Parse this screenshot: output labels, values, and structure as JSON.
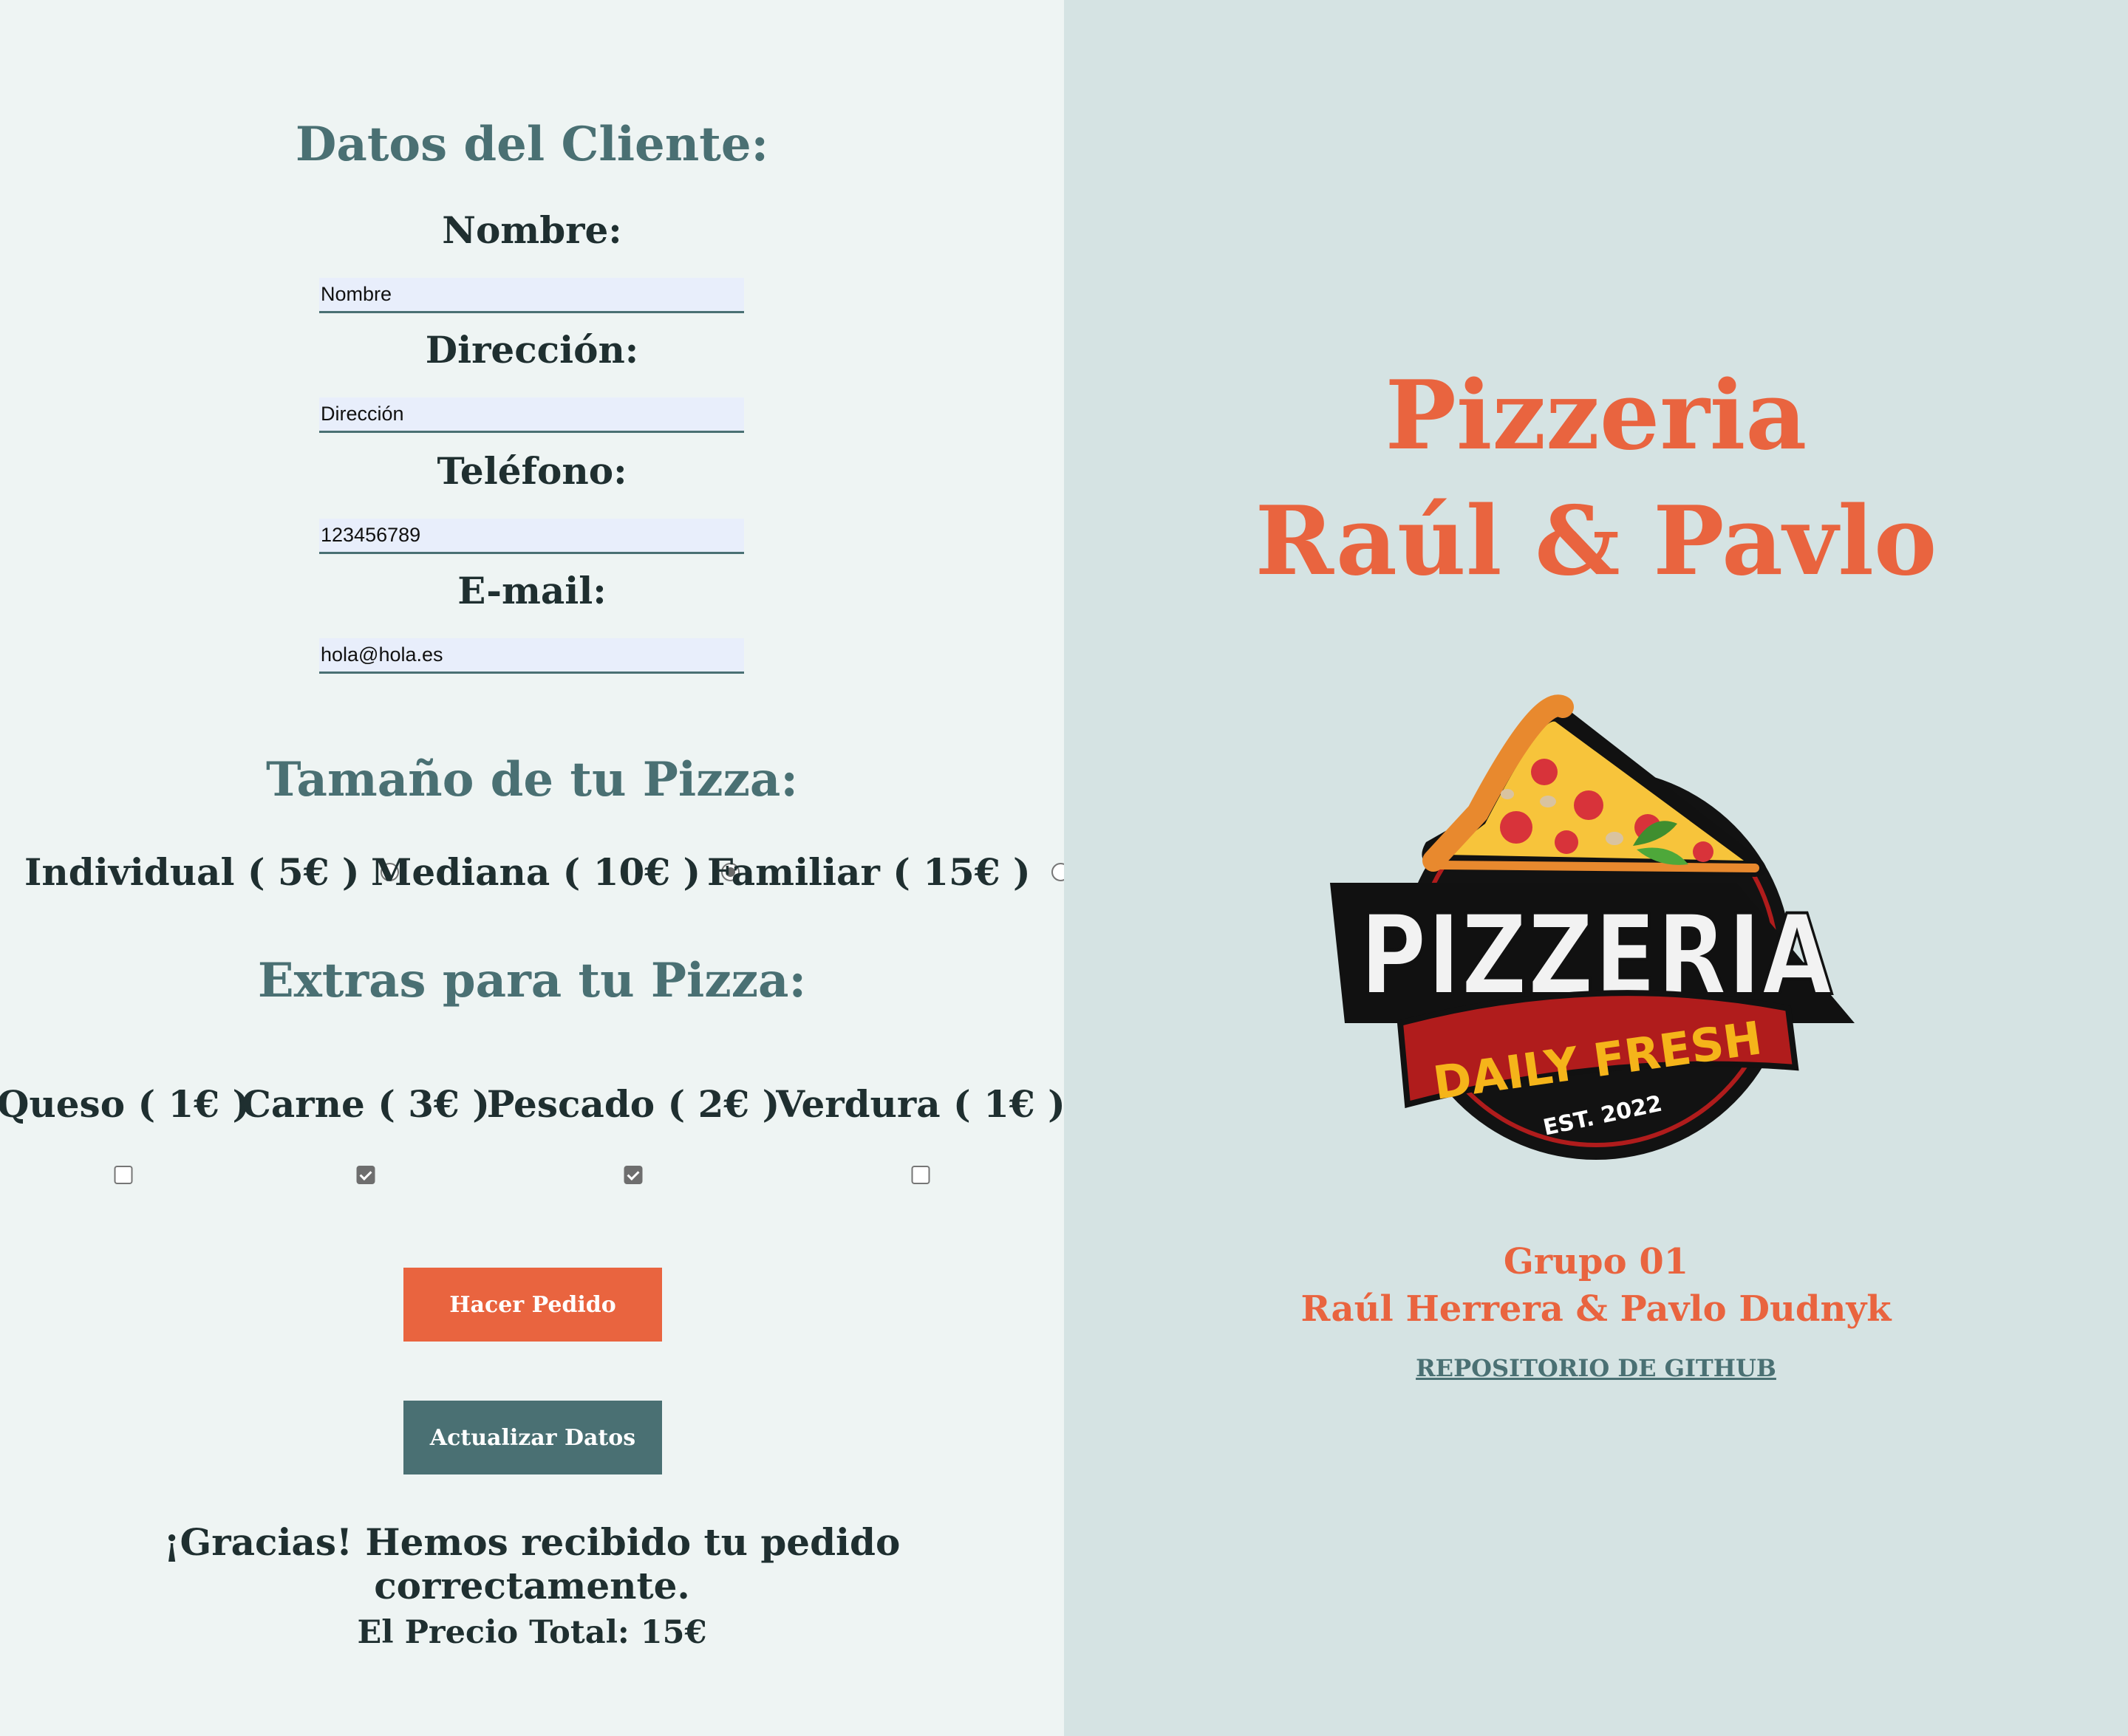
{
  "form": {
    "customer_title": "Datos del Cliente:",
    "name_label": "Nombre:",
    "name_value": "Nombre",
    "address_label": "Dirección:",
    "address_value": "Dirección",
    "phone_label": "Teléfono:",
    "phone_value": "123456789",
    "email_label": "E-mail:",
    "email_value": "hola@hola.es"
  },
  "size": {
    "title": "Tamaño de tu Pizza:",
    "options": [
      {
        "label": "Individual ( 5€ )",
        "selected": false
      },
      {
        "label": "Mediana ( 10€ )",
        "selected": true
      },
      {
        "label": "Familiar ( 15€ )",
        "selected": false
      }
    ]
  },
  "extras": {
    "title": "Extras para tu Pizza:",
    "options": [
      {
        "label": "Queso ( 1€ )",
        "checked": false
      },
      {
        "label": "Carne ( 3€ )",
        "checked": true
      },
      {
        "label": "Pescado ( 2€ )",
        "checked": true
      },
      {
        "label": "Verdura ( 1€ )",
        "checked": false
      }
    ]
  },
  "buttons": {
    "order": "Hacer Pedido",
    "update": "Actualizar Datos"
  },
  "result": {
    "thanks": "¡Gracias! Hemos recibido tu pedido correctamente.",
    "total": "El Precio Total: 15€"
  },
  "brand": {
    "line1": "Pizzeria",
    "line2": "Raúl & Pavlo",
    "logo_word": "PIZZERIA",
    "logo_banner": "DAILY FRESH",
    "logo_est": "EST. 2022",
    "group": "Grupo 01",
    "authors": "Raúl Herrera & Pavlo Dudnyk",
    "github_link": "REPOSITORIO DE GITHUB"
  },
  "colors": {
    "accent": "#e9643f",
    "teal": "#4a7073",
    "left_bg": "#eef4f3",
    "right_bg": "#d5e3e3"
  }
}
